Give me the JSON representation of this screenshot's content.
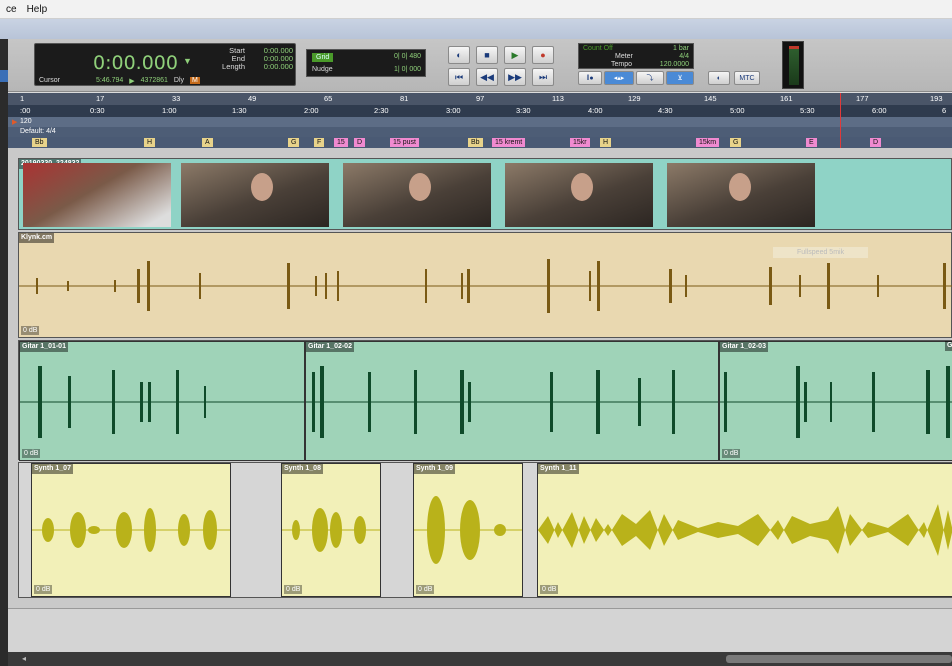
{
  "menu": [
    "ce",
    "Help"
  ],
  "counter": {
    "main_time": "0:00.000",
    "start_label": "Start",
    "end_label": "End",
    "length_label": "Length",
    "start_value": "0:00.000",
    "end_value": "0:00.000",
    "length_value": "0:00.000",
    "cursor_label": "Cursor",
    "cursor_value": "5:46.794",
    "sample_value": "4372861",
    "dly_label": "Dly"
  },
  "grid": {
    "grid_label": "Grid",
    "grid_value": "0| 0| 480",
    "nudge_label": "Nudge",
    "nudge_value": "1| 0| 000"
  },
  "count": {
    "count_off_label": "Count Off",
    "count_off_value": "1 bar",
    "meter_label": "Meter",
    "meter_value": "4/4",
    "tempo_label": "Tempo",
    "tempo_value": "120.0000",
    "mtc_label": "MTC"
  },
  "bars_ruler": [
    "1",
    "17",
    "33",
    "49",
    "65",
    "81",
    "97",
    "113",
    "129",
    "145",
    "161",
    "177",
    "193"
  ],
  "minsec_ruler": [
    ":00",
    "0:30",
    "1:00",
    "1:30",
    "2:00",
    "2:30",
    "3:00",
    "3:30",
    "4:00",
    "4:30",
    "5:00",
    "5:30",
    "6:00",
    "6"
  ],
  "tempo_marker": "120",
  "meter_marker": "Default: 4/4",
  "markers": [
    "Bb",
    "H",
    "A",
    "G",
    "F",
    "15",
    "D",
    "15 pust",
    "Bb",
    "15 kremt",
    "15kr",
    "H",
    "15km",
    "G",
    "E",
    "D"
  ],
  "tracks": {
    "video": {
      "clip_name": "20190330_224832"
    },
    "klynk": {
      "clip_name": "Klynk.cm",
      "gain": "0 dB",
      "ghost": "Fullspeed 5mik"
    },
    "gitar": {
      "clips": [
        "Gitar 1_01-01",
        "Gitar 1_02-02",
        "Gitar 1_02-03",
        "Gi"
      ],
      "gain": "0 dB"
    },
    "synth": {
      "clips": [
        "Synth 1_07",
        "Synth 1_08",
        "Synth 1_09",
        "Synth 1_11"
      ],
      "gain": "0 dB"
    }
  },
  "colors": {
    "video_bg": "#8fd3c6",
    "klynk_bg": "#e9d8b0",
    "klynk_wave": "#7a5a14",
    "gitar_bg": "#9fd3b8",
    "gitar_wave": "#0f4a2a",
    "synth_bg": "#f2f0b8",
    "synth_wave": "#b9b21a",
    "counter_green": "#8fd07a"
  }
}
